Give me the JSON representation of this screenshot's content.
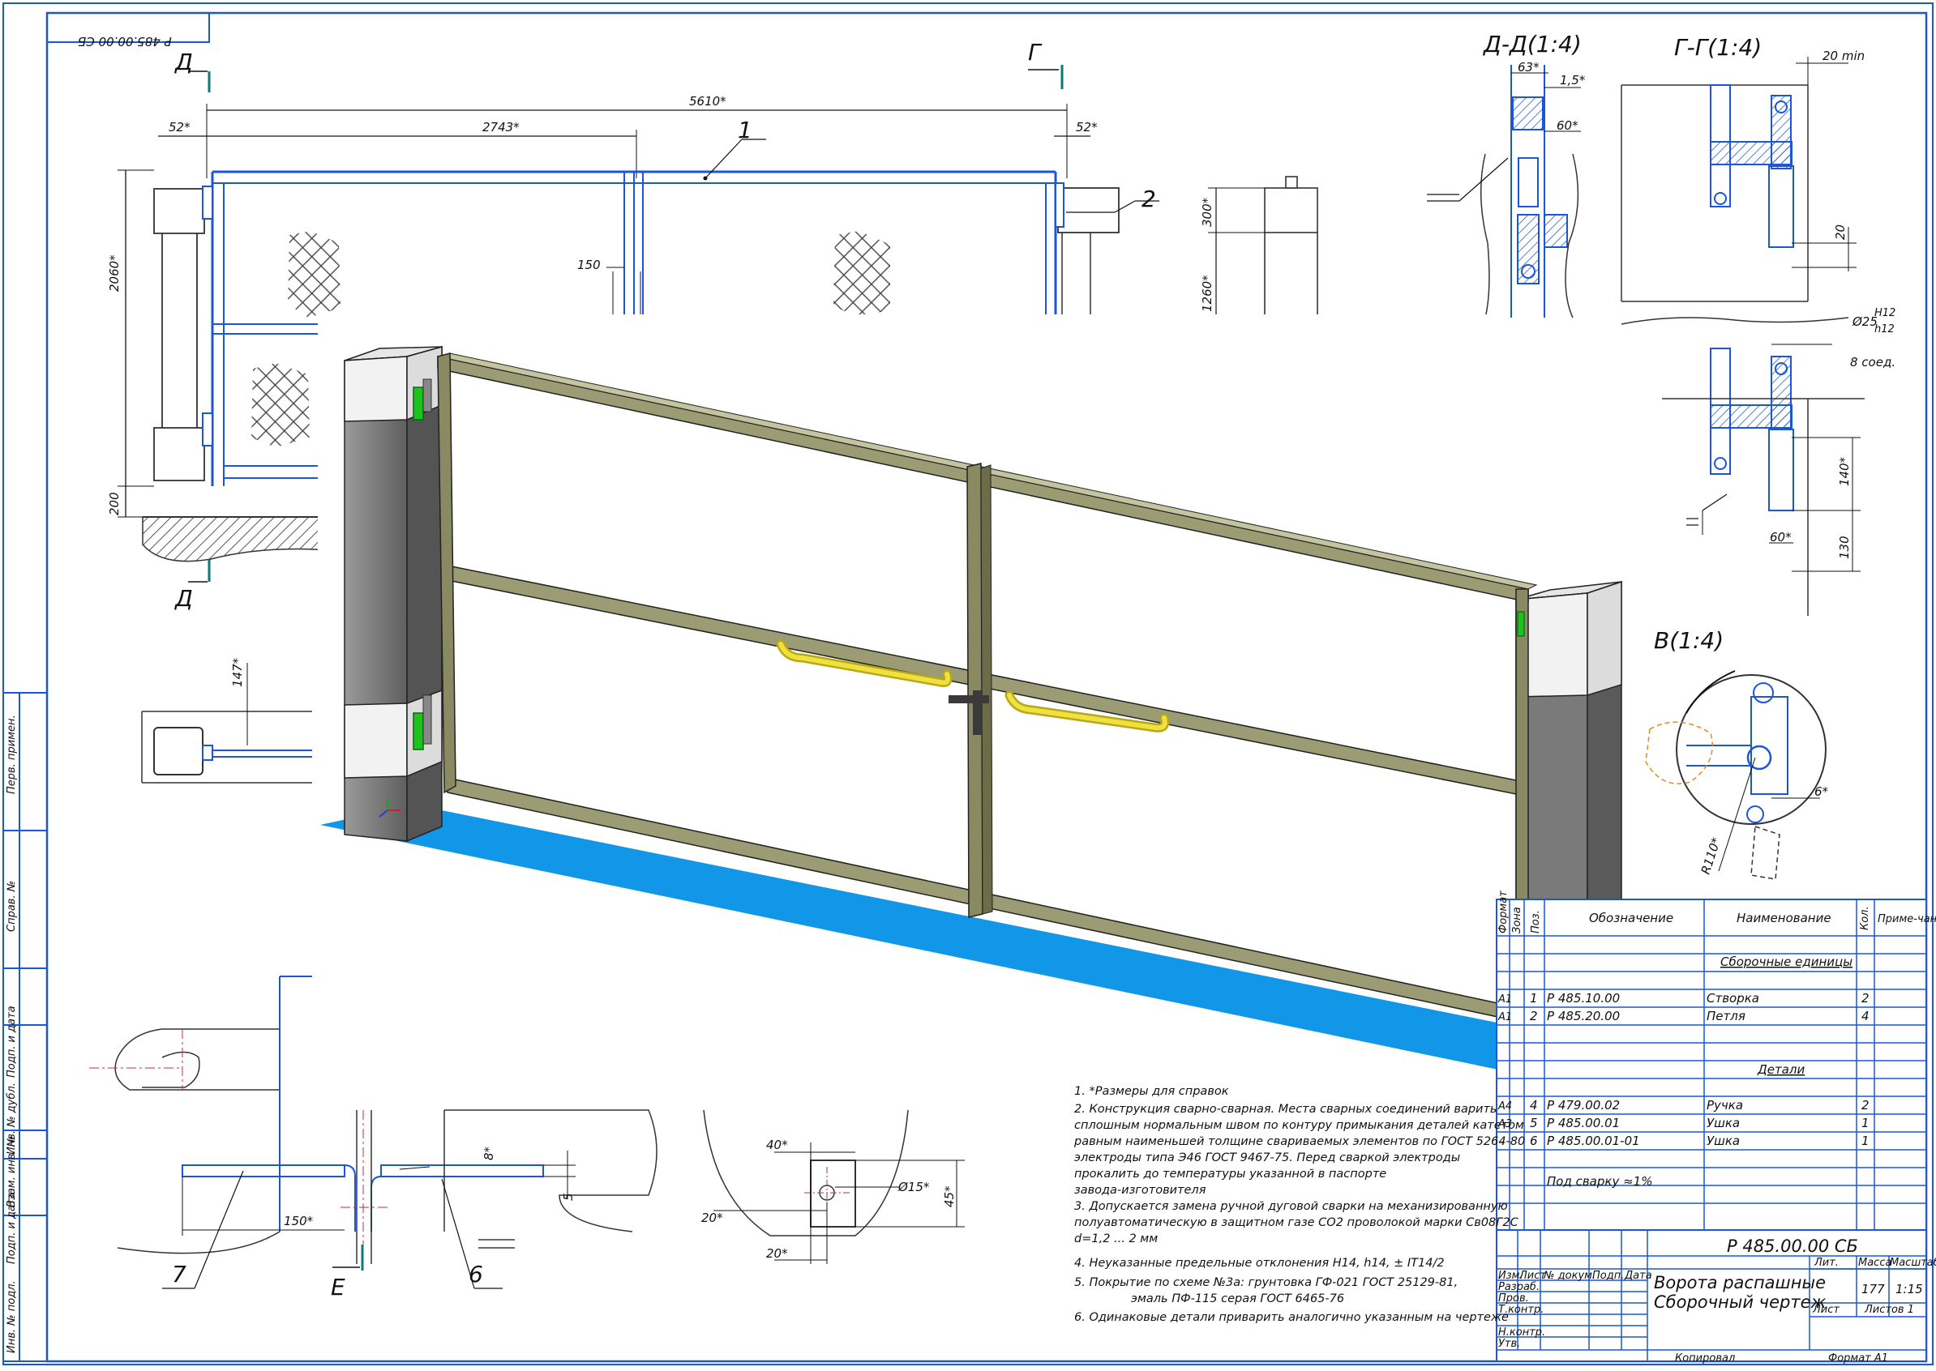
{
  "stamp_code": "Р 485.00.00 СБ",
  "sections": {
    "d": "Д-Д(1:4)",
    "g": "Г-Г(1:4)",
    "v": "В(1:4)",
    "d_letter": "Д",
    "g_letter": "Г",
    "e_letter": "Е"
  },
  "dims": {
    "total": "5610*",
    "leaf": "2743*",
    "side_left": "52*",
    "side_right": "52*",
    "height": "2060*",
    "base": "200",
    "gap150": "150",
    "post300": "300*",
    "post1260": "1260*",
    "d63": "63*",
    "d15": "1,5*",
    "d60": "60*",
    "g20min": "20 min",
    "g20": "20",
    "g_fit": "Ø25",
    "g_fit_h": "H12",
    "g_fit_h2": "h12",
    "g_joints": "8 соед.",
    "g140": "140*",
    "g60": "60*",
    "g130": "130",
    "h147": "147*",
    "v6": "6*",
    "v_r": "R110*",
    "e150": "150*",
    "e8": "8*",
    "e5": "5",
    "u40": "40*",
    "u20a": "20*",
    "u20b": "20*",
    "u_d15": "Ø15*",
    "u45": "45*"
  },
  "callouts": [
    "1",
    "2",
    "6",
    "7"
  ],
  "side_strip": [
    "Перв. примен.",
    "Справ. №",
    "Подп. и дата",
    "Инв. № дубл.",
    "Взам. инв. №",
    "Подп. и дата",
    "Инв. № подл."
  ],
  "notes": [
    "1. *Размеры для справок",
    "2. Конструкция сварно-сварная. Места сварных соединений варить",
    "сплошным нормальным швом по контуру примыкания деталей катетом",
    "равным наименьшей толщине свариваемых элементов по ГОСТ 5264-80",
    "электроды типа Э46 ГОСТ 9467-75. Перед сваркой электроды",
    "прокалить до температуры указанной в паспорте",
    "завода-изготовителя",
    "3. Допускается замена ручной дуговой сварки на механизированную",
    "полуавтоматическую в защитном газе CO2 проволокой марки Св08Г2С",
    "d=1,2 ... 2 мм",
    "4.  Неуказанные предельные отклонения H14, h14, ± IT14/2",
    "5. Покрытие по схеме №3а: грунтовка ГФ-021 ГОСТ 25129-81,",
    "эмаль ПФ-115 серая ГОСТ 6465-76",
    "6. Одинаковые детали приварить аналогично указанным на чертеже"
  ],
  "spec": {
    "headers": [
      "Формат",
      "Зона",
      "Поз.",
      "Обозначение",
      "Наименование",
      "Кол.",
      "Приме-чание"
    ],
    "group1": "Сборочные единицы",
    "group2": "Детали",
    "rows1": [
      {
        "fmt": "А1",
        "pos": "1",
        "code": "Р 485.10.00",
        "name": "Створка",
        "qty": "2"
      },
      {
        "fmt": "А1",
        "pos": "2",
        "code": "Р 485.20.00",
        "name": "Петля",
        "qty": "4"
      }
    ],
    "rows2": [
      {
        "fmt": "А4",
        "pos": "4",
        "code": "Р 479.00.02",
        "name": "Ручка",
        "qty": "2"
      },
      {
        "fmt": "А3",
        "pos": "5",
        "code": "Р 485.00.01",
        "name": "Ушка",
        "qty": "1"
      },
      {
        "fmt": "-",
        "pos": "6",
        "code": "Р 485.00.01-01",
        "name": "Ушка",
        "qty": "1"
      }
    ],
    "weld": "Под сварку ≈1%"
  },
  "title_block": {
    "code": "Р 485.00.00 СБ",
    "name1": "Ворота распашные",
    "name2": "Сборочный чертеж",
    "lit": "Лит.",
    "mass": "Масса",
    "scale": "Масштаб",
    "mass_val": "177",
    "scale_val": "1:15",
    "sheet": "Лист",
    "sheets": "Листов   1",
    "rows": [
      "Изм.",
      "Лист",
      "№ докум.",
      "Подп.",
      "Дата",
      "Разраб.",
      "Пров.",
      "Т.контр.",
      "Н.контр.",
      "Утв."
    ],
    "copied": "Копировал",
    "format": "Формат    А1"
  },
  "colors": {
    "blue": "#1a56d6",
    "frame": "#8a8a62",
    "handle": "#e8d62a",
    "floor": "#1196e8",
    "post": "#6c6c6c",
    "cap": "#f0f0f0",
    "green": "#1ec21e"
  }
}
